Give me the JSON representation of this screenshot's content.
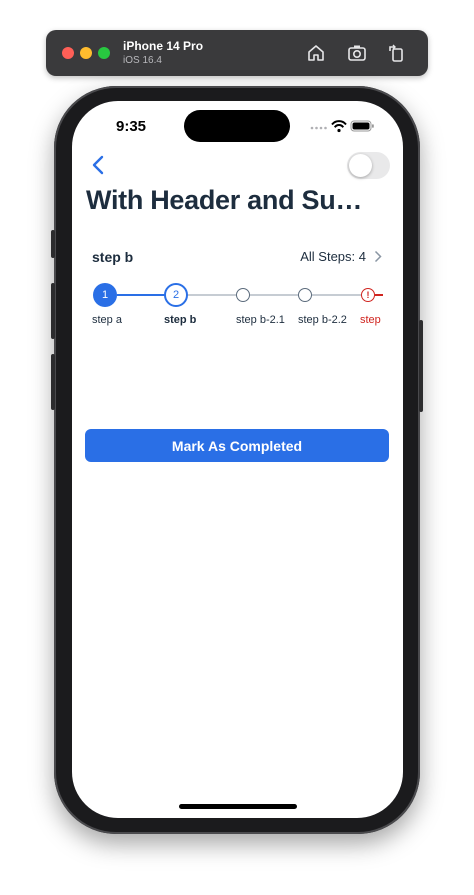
{
  "simulator": {
    "device_name": "iPhone 14 Pro",
    "os_version": "iOS 16.4",
    "toolbar_icons": [
      "home-icon",
      "screenshot-icon",
      "rotate-icon"
    ]
  },
  "status_bar": {
    "time": "9:35",
    "icons": [
      "cellular-dots-icon",
      "wifi-icon",
      "battery-icon"
    ]
  },
  "nav": {
    "back_icon": "chevron-left-icon",
    "toggle_on": false
  },
  "page": {
    "title": "With Header and Su…"
  },
  "stepper": {
    "current_step_title": "step b",
    "all_steps_label": "All Steps: 4",
    "steps": [
      {
        "label": "step a",
        "marker": "1",
        "state": "completed"
      },
      {
        "label": "step b",
        "marker": "2",
        "state": "active"
      },
      {
        "label": "step b-2.1",
        "marker": "",
        "state": "pending"
      },
      {
        "label": "step b-2.2",
        "marker": "",
        "state": "pending"
      },
      {
        "label": "step",
        "marker": "!",
        "state": "error"
      }
    ]
  },
  "actions": {
    "primary_label": "Mark As Completed"
  },
  "colors": {
    "accent": "#2a6fe6",
    "error": "#d0241f",
    "title_text": "#1d2d3e"
  }
}
